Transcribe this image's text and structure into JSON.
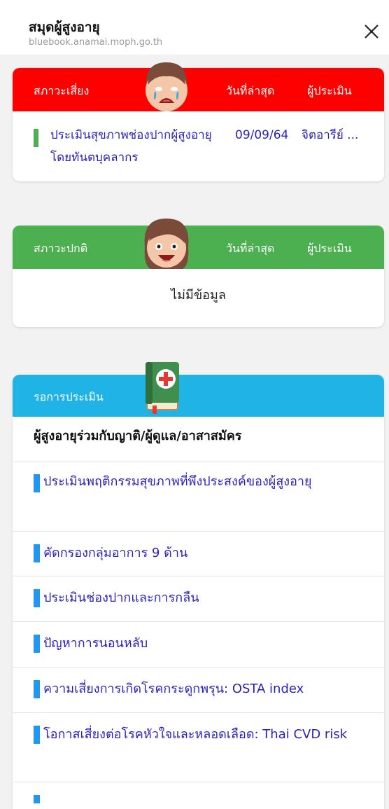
{
  "header": {
    "title": "สมุดผู้สูงอายุ",
    "url": "bluebook.anamai.moph.go.th"
  },
  "risk": {
    "label": "สภาวะเสี่ยง",
    "date_header": "วันที่ล่าสุด",
    "assessor_header": "ผู้ประเมิน",
    "color": "#ff0000",
    "item": {
      "title": "ประเมินสุขภาพช่องปากผู้สูงอายุโดยทันตบุคลากร",
      "date": "09/09/64",
      "assessor": "จิตอารีย์ ..."
    }
  },
  "normal": {
    "label": "สภาวะปกติ",
    "date_header": "วันที่ล่าสุด",
    "assessor_header": "ผู้ประเมิน",
    "color": "#4caf50",
    "empty_text": "ไม่มีข้อมูล"
  },
  "pending": {
    "label": "รอการประเมิน",
    "color": "#1fb3e6",
    "group_title": "ผู้สูงอายุร่วมกับญาติ/ผู้ดูแล/อาสาสมัคร",
    "items": [
      "ประเมินพฤติกรรมสุขภาพที่พึงประสงค์ของผู้สูงอายุ",
      "คัดกรองกลุ่มอาการ 9 ด้าน",
      "ประเมินช่องปากและการกลืน",
      "ปัญหาการนอนหลับ",
      "ความเสี่ยงการเกิดโรคกระดูกพรุน: OSTA index",
      "โอกาสเสี่ยงต่อโรคหัวใจและหลอดเลือด: Thai CVD risk"
    ]
  },
  "icons": {
    "close": "close-icon",
    "crying_face": "crying-face-icon",
    "happy_face": "happy-face-icon",
    "medical_book": "medical-book-icon"
  }
}
